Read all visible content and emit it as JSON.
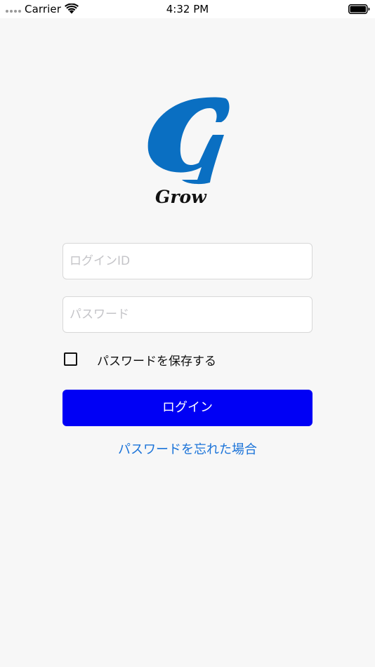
{
  "status_bar": {
    "carrier": "Carrier",
    "time": "4:32 PM"
  },
  "logo": {
    "icon": "g-logo-icon",
    "wordmark": "Grow",
    "color": "#0a6fc2"
  },
  "form": {
    "login_id_placeholder": "ログインID",
    "login_id_value": "",
    "password_placeholder": "パスワード",
    "password_value": "",
    "save_password_label": "パスワードを保存する",
    "save_password_checked": false,
    "login_button_label": "ログイン",
    "forgot_password_link": "パスワードを忘れた場合"
  },
  "colors": {
    "background": "#f7f7f7",
    "button": "#0000f5",
    "link": "#1a73d9"
  }
}
